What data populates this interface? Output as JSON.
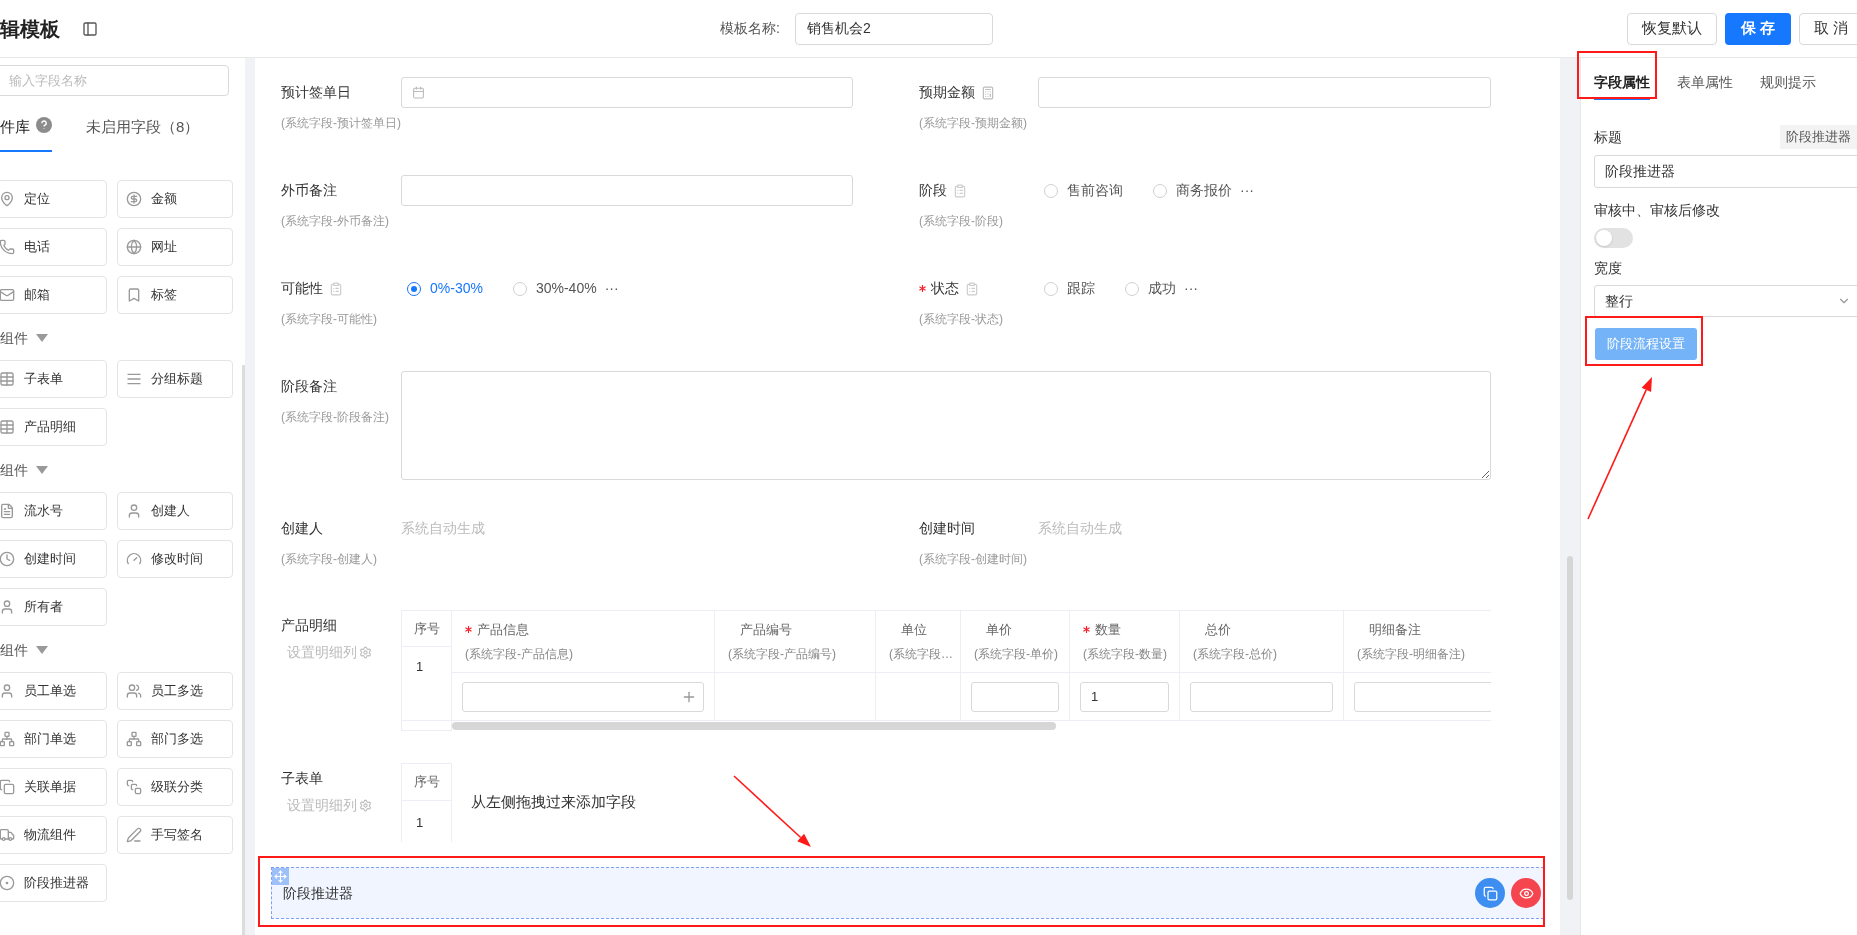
{
  "header": {
    "title": "辑模板",
    "name_label": "模板名称:",
    "name_value": "销售机会2",
    "buttons": [
      {
        "label": "恢复默认",
        "kind": "default"
      },
      {
        "label": "保 存",
        "kind": "primary"
      },
      {
        "label": "取 消",
        "kind": "default"
      }
    ]
  },
  "sidebar": {
    "search_placeholder": "输入字段名称",
    "tabs": [
      {
        "label": "件库",
        "selected": true,
        "help": true
      },
      {
        "label": "未启用字段（8）",
        "selected": false,
        "help": false
      }
    ],
    "sections": [
      {
        "items": [
          "定位",
          "金额",
          "电话",
          "网址",
          "邮箱",
          "标签"
        ]
      },
      {
        "heading": "组件",
        "items": [
          "子表单",
          "分组标题",
          "产品明细"
        ]
      },
      {
        "heading": "组件",
        "items": [
          "流水号",
          "创建人",
          "创建时间",
          "修改时间",
          "所有者"
        ]
      },
      {
        "heading": "组件",
        "items": [
          "员工单选",
          "员工多选",
          "部门单选",
          "部门多选",
          "关联单据",
          "级联分类",
          "物流组件",
          "手写签名",
          "阶段推进器"
        ]
      }
    ]
  },
  "form": {
    "rows": [
      [
        {
          "kind": "date",
          "label": "预计签单日",
          "sub": "(系统字段-预计签单日)",
          "required": false
        },
        {
          "kind": "amount",
          "label": "预期金额",
          "sub": "(系统字段-预期金额)",
          "required": false
        }
      ],
      [
        {
          "kind": "text",
          "label": "外币备注",
          "sub": "(系统字段-外币备注)",
          "required": false
        },
        {
          "kind": "radio",
          "label": "阶段",
          "sub": "(系统字段-阶段)",
          "required": false,
          "options": [
            {
              "label": "售前咨询",
              "selected": false
            },
            {
              "label": "商务报价",
              "selected": false
            }
          ],
          "more": "···"
        }
      ],
      [
        {
          "kind": "radio",
          "label": "可能性",
          "sub": "(系统字段-可能性)",
          "required": false,
          "options": [
            {
              "label": "0%-30%",
              "selected": true
            },
            {
              "label": "30%-40%",
              "selected": false
            }
          ],
          "more": "···"
        },
        {
          "kind": "radio",
          "label": "状态",
          "sub": "(系统字段-状态)",
          "required": true,
          "options": [
            {
              "label": "跟踪",
              "selected": false
            },
            {
              "label": "成功",
              "selected": false
            }
          ],
          "more": "···"
        }
      ],
      [
        {
          "kind": "textarea",
          "label": "阶段备注",
          "sub": "(系统字段-阶段备注)",
          "required": false
        }
      ],
      [
        {
          "kind": "auto",
          "label": "创建人",
          "sub": "(系统字段-创建人)",
          "required": false,
          "value": "系统自动生成"
        },
        {
          "kind": "auto",
          "label": "创建时间",
          "sub": "(系统字段-创建时间)",
          "required": false,
          "value": "系统自动生成"
        }
      ]
    ],
    "product_table": {
      "label": "产品明细",
      "setting": "设置明细列",
      "index_header": "序号",
      "row_index": "1",
      "columns": [
        {
          "label": "产品信息",
          "sub": "(系统字段-产品信息)",
          "required": true,
          "kind": "picker"
        },
        {
          "label": "产品编号",
          "sub": "(系统字段-产品编号)",
          "required": false,
          "kind": "empty"
        },
        {
          "label": "单位",
          "sub": "(系统字段…",
          "required": false,
          "kind": "empty"
        },
        {
          "label": "单价",
          "sub": "(系统字段-单价)",
          "required": false,
          "kind": "input"
        },
        {
          "label": "数量",
          "sub": "(系统字段-数量)",
          "required": true,
          "kind": "input",
          "value": "1"
        },
        {
          "label": "总价",
          "sub": "(系统字段-总价)",
          "required": false,
          "kind": "input"
        },
        {
          "label": "明细备注",
          "sub": "(系统字段-明细备注)",
          "required": false,
          "kind": "input"
        }
      ]
    },
    "subform": {
      "label": "子表单",
      "setting": "设置明细列",
      "index_header": "序号",
      "row_index": "1",
      "hint": "从左侧拖拽过来添加字段"
    },
    "selected_field": {
      "label": "阶段推进器",
      "selected": true
    }
  },
  "properties": {
    "tabs": [
      {
        "label": "字段属性",
        "selected": true
      },
      {
        "label": "表单属性",
        "selected": false
      },
      {
        "label": "规则提示",
        "selected": false
      }
    ],
    "title_label": "标题",
    "title_tag": "阶段推进器",
    "title_value": "阶段推进器",
    "toggle": {
      "label": "审核中、审核后修改",
      "on": false
    },
    "width_label": "宽度",
    "width_value": "整行",
    "action": "阶段流程设置"
  }
}
